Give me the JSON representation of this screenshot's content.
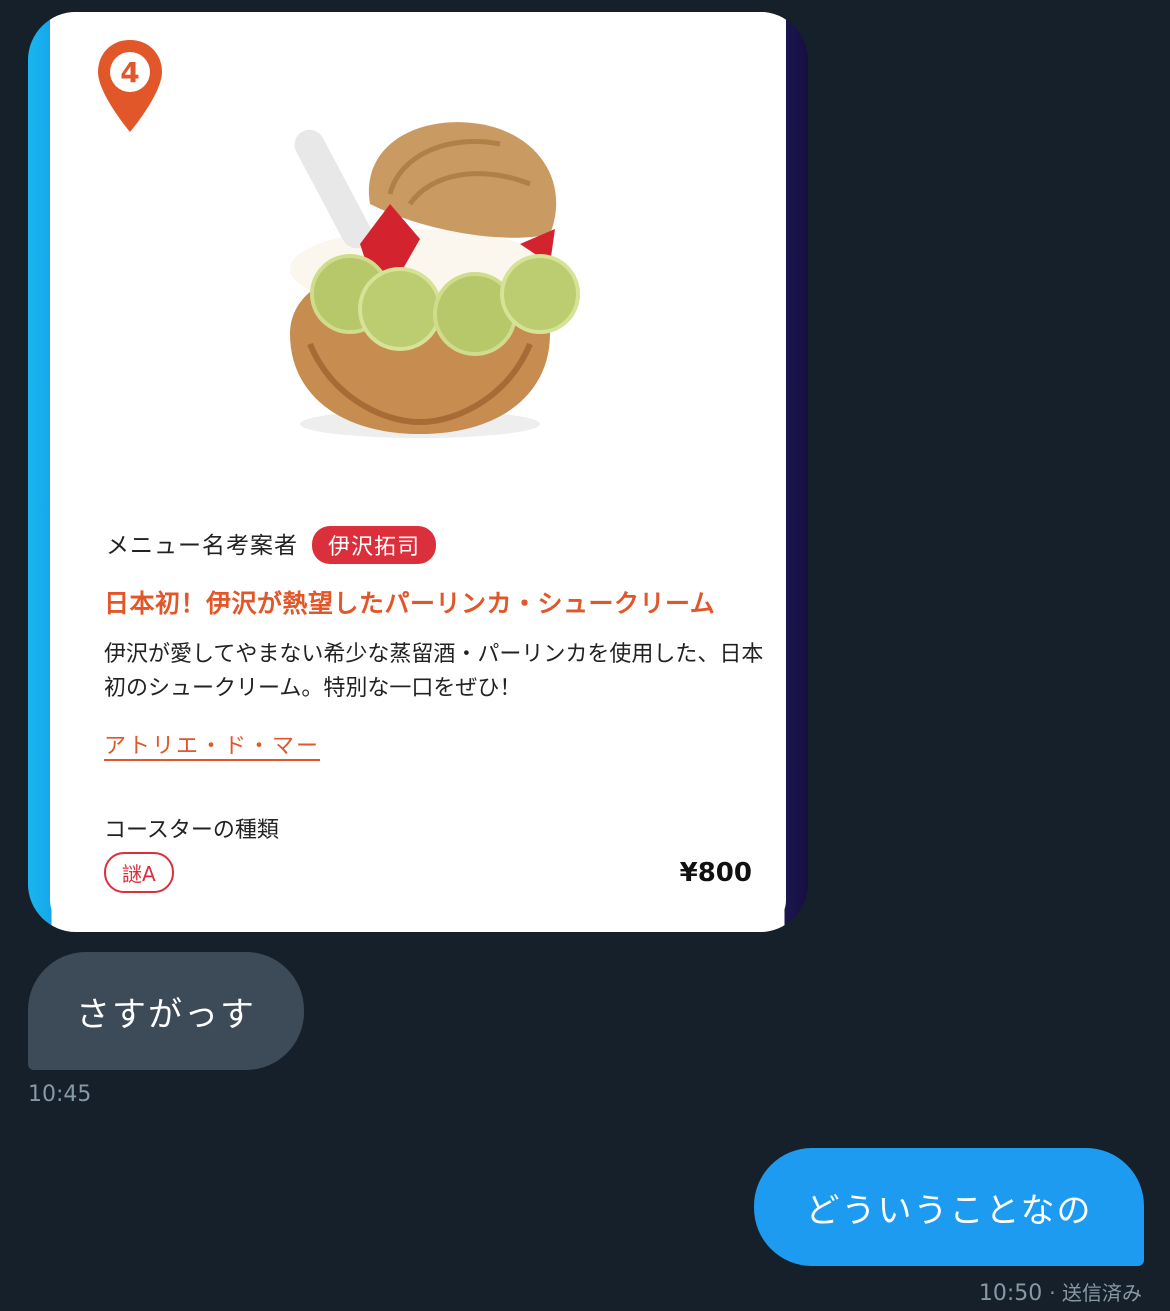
{
  "card": {
    "pin_number": "4",
    "menu_name_label": "メニュー名考案者",
    "chef_name": "伊沢拓司",
    "title": "日本初！伊沢が熱望したパーリンカ・シュークリーム",
    "description": "伊沢が愛してやまない希少な蒸留酒・パーリンカを使用した、日本初のシュークリーム。特別な一口をぜひ！",
    "shop_link": "アトリエ・ド・マー",
    "coaster_label": "コースターの種類",
    "coaster_type": "謎A",
    "price": "¥800",
    "accent_color": "#e2572a",
    "badge_color": "#dc2f3c"
  },
  "messages": [
    {
      "direction": "incoming",
      "text": "さすがっす",
      "time": "10:45"
    },
    {
      "direction": "outgoing",
      "text": "どういうことなの",
      "time": "10:50",
      "status": "· 送信済み"
    }
  ],
  "colors": {
    "background": "#15202b",
    "incoming_bubble": "#3d4a58",
    "outgoing_bubble": "#1d9bf0"
  }
}
